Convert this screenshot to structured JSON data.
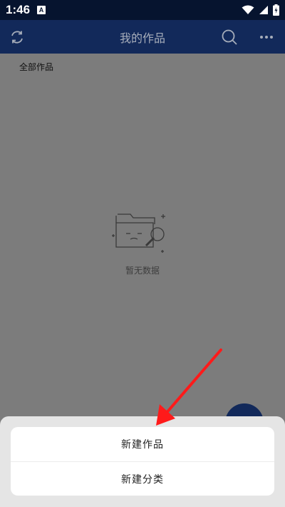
{
  "status_bar": {
    "time": "1:46",
    "notification_badge": "A"
  },
  "app_bar": {
    "title": "我的作品"
  },
  "content": {
    "section_label": "全部作品",
    "empty_text": "暂无数据"
  },
  "sheet": {
    "items": [
      {
        "label": "新建作品"
      },
      {
        "label": "新建分类"
      }
    ]
  },
  "colors": {
    "app_bar": "#12295a",
    "status_bar": "#06142f",
    "annotation_arrow": "#ff1a1a"
  }
}
